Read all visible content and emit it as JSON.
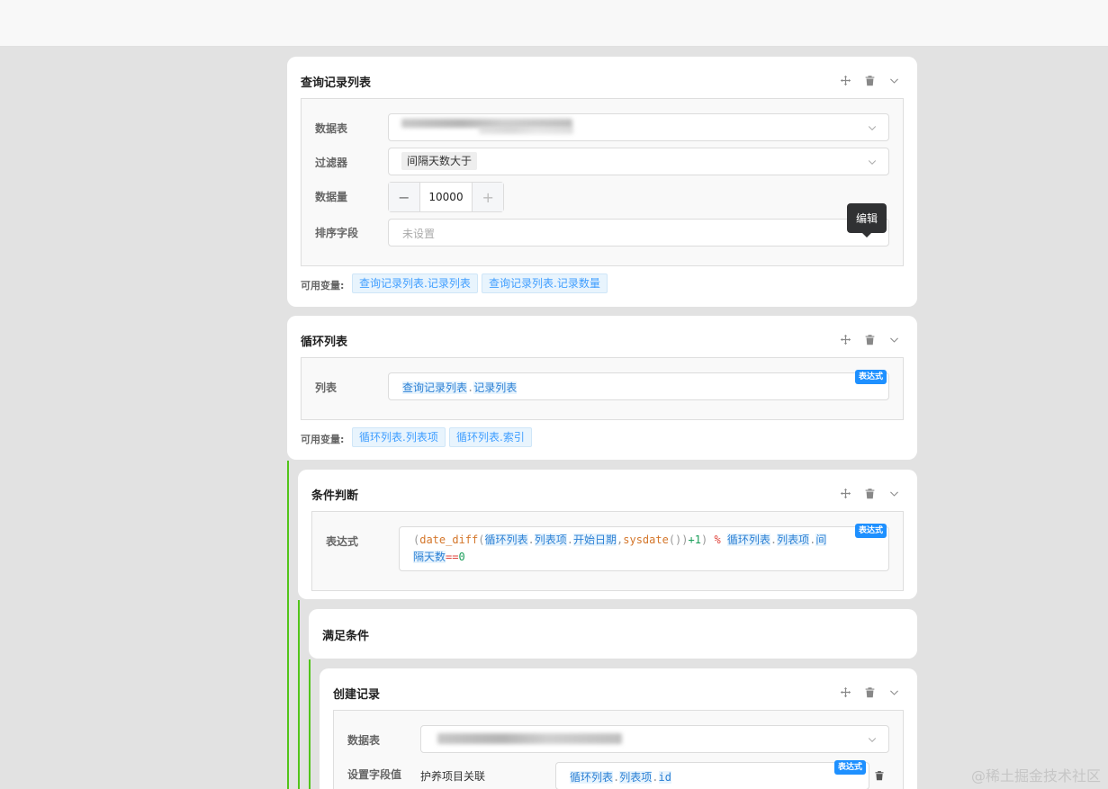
{
  "cards": {
    "query": {
      "title": "查询记录列表",
      "labels": {
        "table": "数据表",
        "filter": "过滤器",
        "count": "数据量",
        "sort": "排序字段"
      },
      "filter_value": "间隔天数大于",
      "count_value": "10000",
      "sort_placeholder": "未设置",
      "tooltip": "编辑",
      "vars_label": "可用变量:",
      "vars": [
        "查询记录列表.记录列表",
        "查询记录列表.记录数量"
      ]
    },
    "loop": {
      "title": "循环列表",
      "label_list": "列表",
      "expr_badge": "表达式",
      "expr": {
        "a": "查询记录列表",
        "b": "记录列表"
      },
      "vars_label": "可用变量:",
      "vars": [
        "循环列表.列表项",
        "循环列表.索引"
      ]
    },
    "cond": {
      "title": "条件判断",
      "label_expr": "表达式",
      "expr_badge": "表达式",
      "code": {
        "p1": "(",
        "fn": "date_diff",
        "p2": "(",
        "t1": "循环列表",
        "t2": "列表项",
        "t3": "开始日期",
        "comma": ",",
        "fn2": "sysdate",
        "p3": "())",
        "plus": "+1",
        "p4": ")",
        "mod": "%",
        "t4": "循环列表",
        "t5": "列表项",
        "t6": "间",
        "t7": "隔天数",
        "eq": "==",
        "zero": "0"
      }
    },
    "met": {
      "title": "满足条件"
    },
    "create": {
      "title": "创建记录",
      "labels": {
        "table": "数据表",
        "set_fields": "设置字段值"
      },
      "field_name": "护养项目关联",
      "expr_badge": "表达式",
      "expr": {
        "a": "循环列表",
        "b": "列表项",
        "c": "id"
      }
    }
  },
  "icons": {
    "move": "move-icon",
    "delete": "trash-icon",
    "collapse": "chevron-down-icon"
  },
  "watermark": "@稀土掘金技术社区",
  "colors": {
    "accent": "#409eff",
    "branch": "#52c41a",
    "badge": "#1e90ff"
  }
}
